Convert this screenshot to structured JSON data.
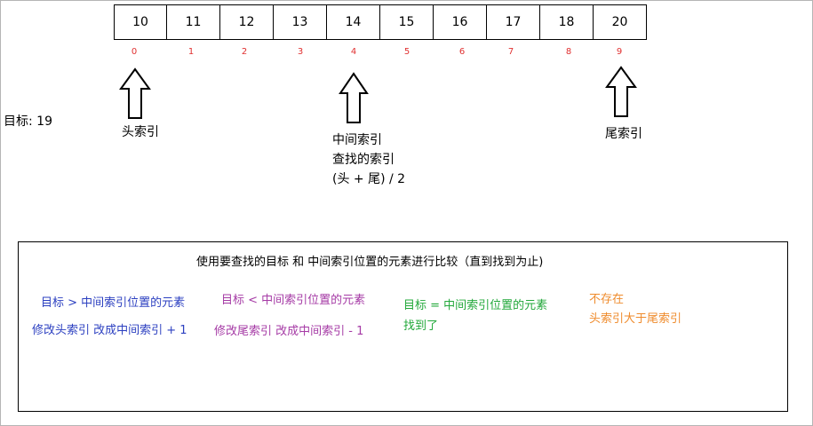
{
  "array": {
    "values": [
      "10",
      "11",
      "12",
      "13",
      "14",
      "15",
      "16",
      "17",
      "18",
      "20"
    ],
    "indices": [
      "0",
      "1",
      "2",
      "3",
      "4",
      "5",
      "6",
      "7",
      "8",
      "9"
    ]
  },
  "target_label": "目标: 19",
  "pointers": {
    "head": "头索引",
    "mid": [
      "中间索引",
      "查找的索引",
      "(头 + 尾) / 2"
    ],
    "tail": "尾索引"
  },
  "panel": {
    "title": "使用要查找的目标 和  中间索引位置的元素进行比较（直到找到为止)",
    "case_greater": [
      "目标  >  中间索引位置的元素",
      "修改头索引  改成中间索引 + 1"
    ],
    "case_less": [
      "目标 < 中间索引位置的元素",
      "修改尾索引  改成中间索引 - 1"
    ],
    "case_equal": [
      "目标 = 中间索引位置的元素",
      "找到了"
    ],
    "case_missing": [
      "不存在",
      "头索引大于尾索引"
    ]
  },
  "colors": {
    "index": "#e03030",
    "greater": "#2b3fc0",
    "less": "#a53aa5",
    "equal": "#22a83a",
    "missing": "#ef8b2c"
  }
}
